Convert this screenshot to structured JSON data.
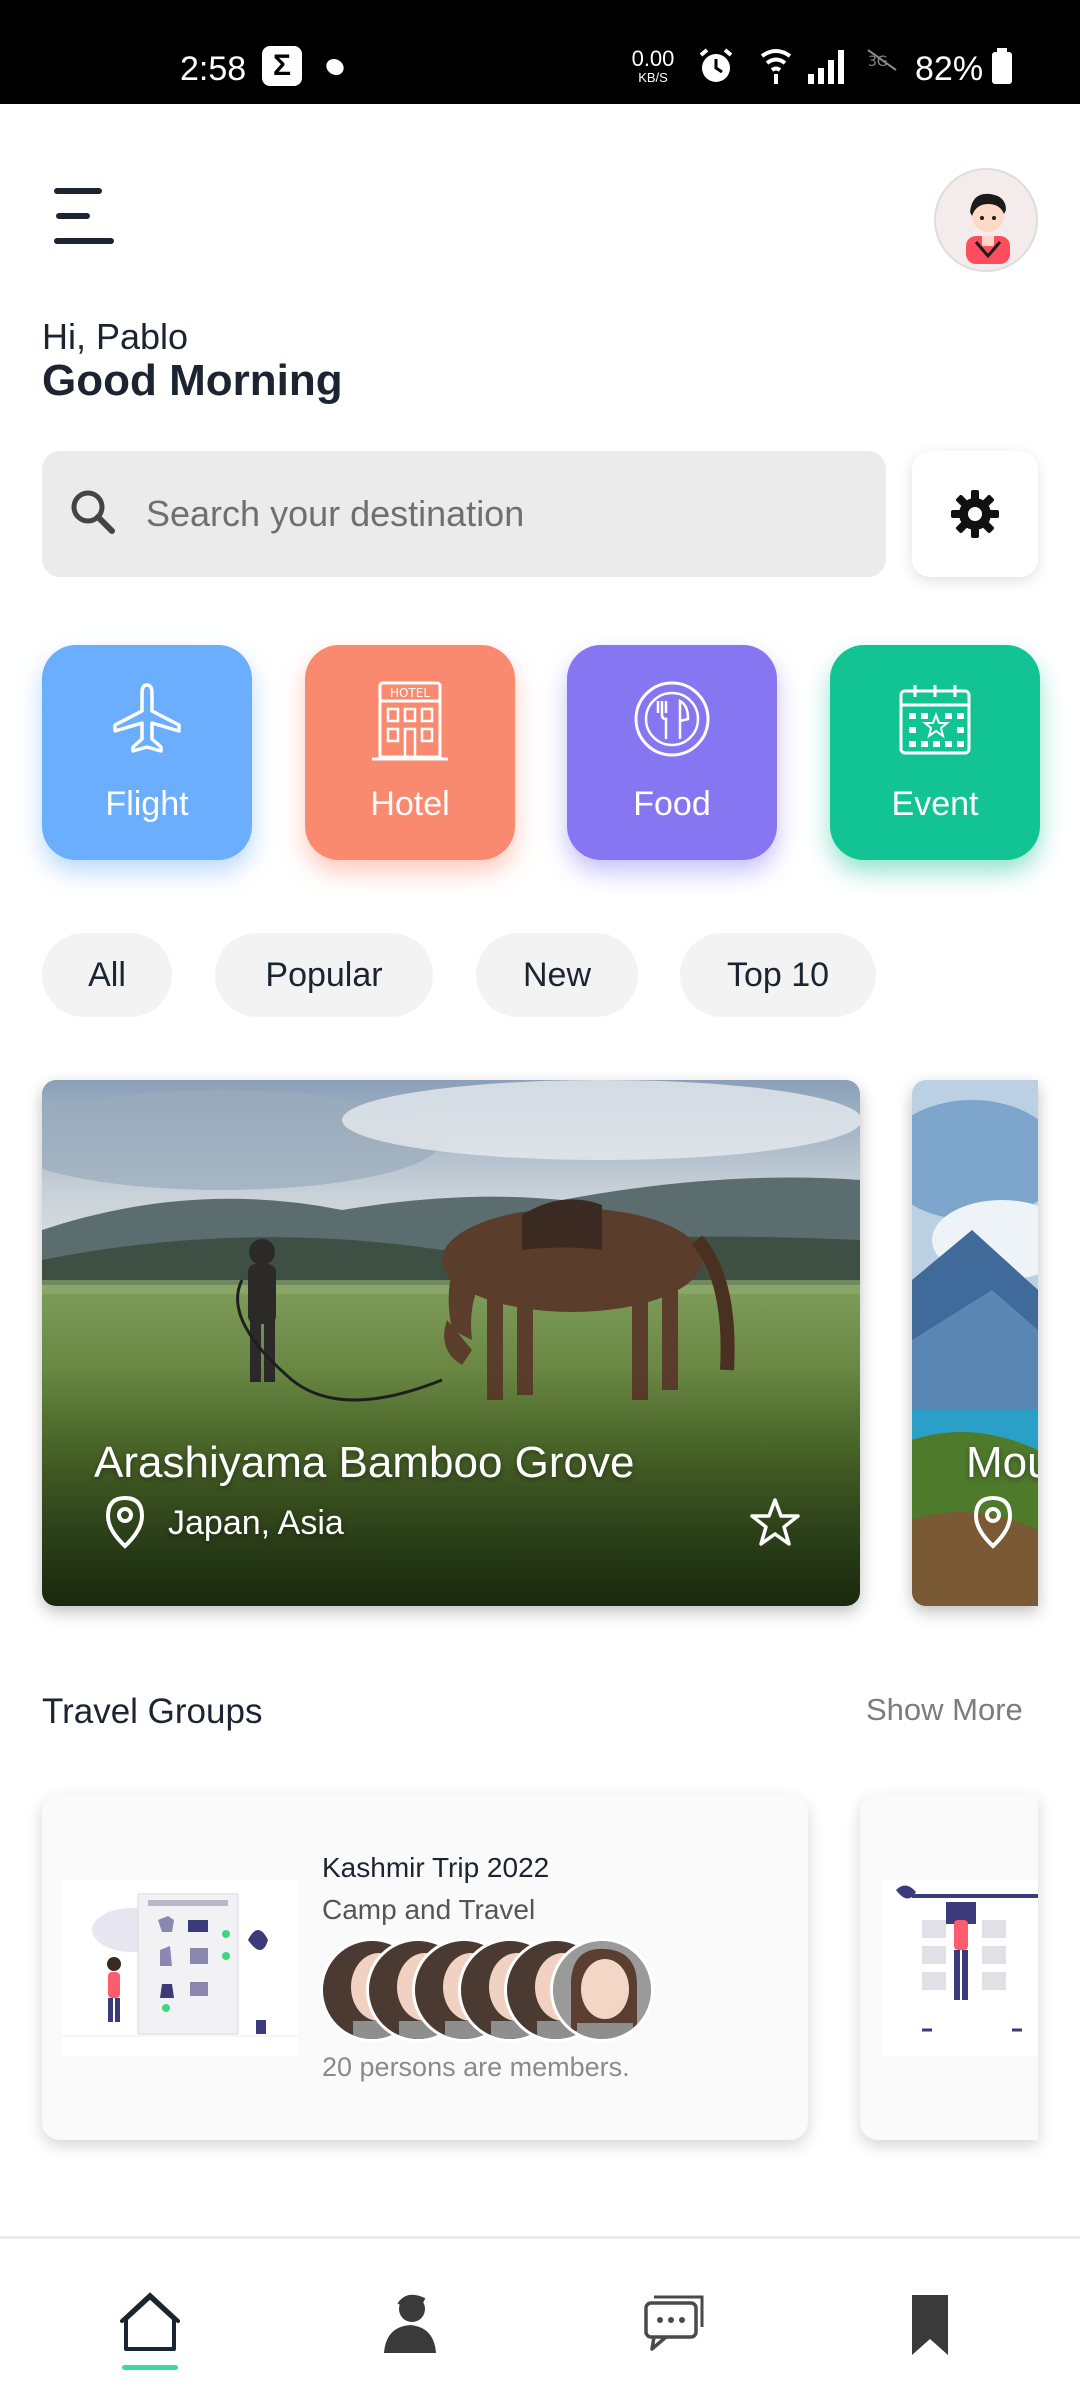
{
  "status_bar": {
    "time": "2:58",
    "net_speed_value": "0.00",
    "net_speed_unit": "KB/S",
    "battery": "82%"
  },
  "header": {
    "greeting": "Hi, Pablo",
    "title": "Good Morning"
  },
  "search": {
    "placeholder": "Search your destination"
  },
  "categories": [
    {
      "label": "Flight",
      "color": "#6aaefd",
      "icon": "airplane-icon"
    },
    {
      "label": "Hotel",
      "color": "#fa8a6f",
      "icon": "hotel-icon"
    },
    {
      "label": "Food",
      "color": "#8676f2",
      "icon": "food-icon"
    },
    {
      "label": "Event",
      "color": "#12c493",
      "icon": "calendar-icon"
    }
  ],
  "filters": [
    "All",
    "Popular",
    "New",
    "Top 10"
  ],
  "destinations": [
    {
      "title": "Arashiyama Bamboo Grove",
      "location": "Japan, Asia"
    },
    {
      "title": "Mou",
      "location": ""
    }
  ],
  "travel_groups": {
    "title": "Travel Groups",
    "show_more": "Show More",
    "groups": [
      {
        "name": "Kashmir Trip 2022",
        "subtitle": "Camp and Travel",
        "members_text": "20  persons are members."
      }
    ]
  },
  "bottom_nav": {
    "accent": "#3ed7a0",
    "items": [
      "home-icon",
      "profile-icon",
      "chat-icon",
      "bookmark-icon"
    ]
  }
}
